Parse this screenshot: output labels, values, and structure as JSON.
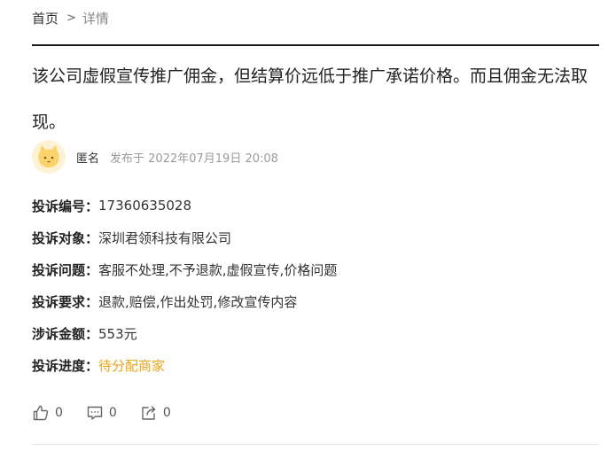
{
  "breadcrumb": {
    "home": "首页",
    "separator": ">",
    "current": "详情"
  },
  "complaint": {
    "title": "该公司虚假宣传推广佣金，但结算价远低于推广承诺价格。而且佣金无法取现。",
    "author": {
      "name": "匿名",
      "avatar_icon": "cat-avatar-icon",
      "post_time": "发布于 2022年07月19日 20:08"
    },
    "fields": [
      {
        "label": "投诉编号：",
        "value": "17360635028"
      },
      {
        "label": "投诉对象：",
        "value": "深圳君领科技有限公司"
      },
      {
        "label": "投诉问题：",
        "value": "客服不处理,不予退款,虚假宣传,价格问题"
      },
      {
        "label": "投诉要求：",
        "value": "退款,赔偿,作出处罚,修改宣传内容"
      },
      {
        "label": "涉诉金额：",
        "value": "553元"
      },
      {
        "label": "投诉进度：",
        "value": "待分配商家"
      }
    ]
  },
  "actions": {
    "like": {
      "icon": "thumbs-up-icon",
      "count": "0"
    },
    "comment": {
      "icon": "comment-icon",
      "count": "0"
    },
    "share": {
      "icon": "share-icon",
      "count": "0"
    }
  },
  "colors": {
    "status": "#e8a317",
    "muted": "#9a9a9a",
    "divider": "#1a1a1a",
    "avatar_bg": "#fdf1d6"
  }
}
